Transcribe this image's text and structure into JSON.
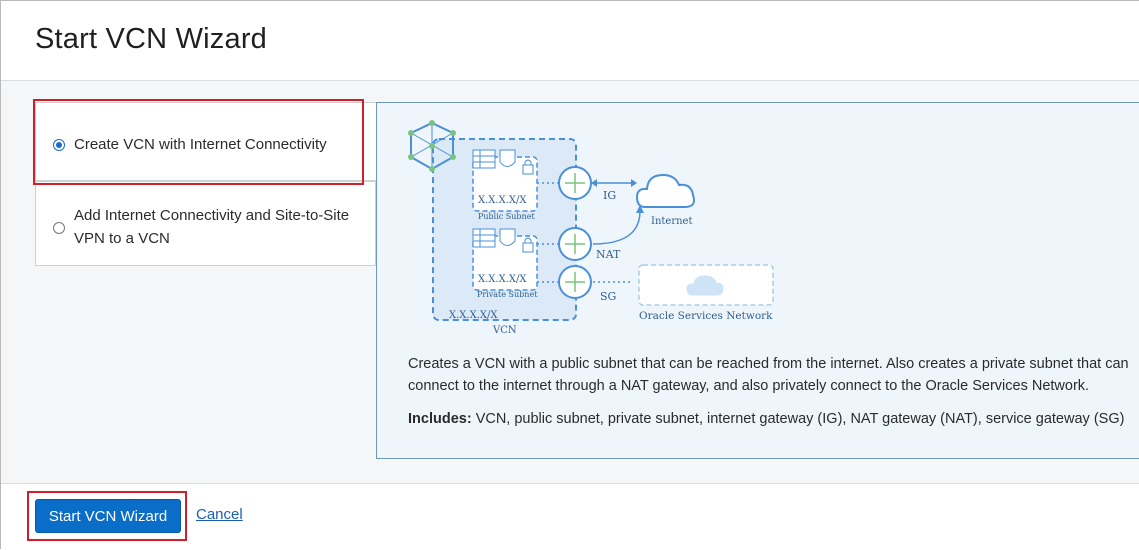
{
  "dialog": {
    "title": "Start VCN Wizard"
  },
  "options": [
    {
      "label_line1": "Create VCN with Internet Connectivity",
      "label_line2": "",
      "selected": true
    },
    {
      "label_line1": "Add Internet Connectivity and Site-to-Site",
      "label_line2": "VPN to a VCN",
      "selected": false
    }
  ],
  "diagram": {
    "public_cidr": "X.X.X.X/X",
    "public_subnet_label": "Public Subnet",
    "private_cidr": "X.X.X.X/X",
    "private_subnet_label": "Private Subnet",
    "vcn_cidr": "X.X.X.X/X",
    "vcn_label": "VCN",
    "ig_label": "IG",
    "nat_label": "NAT",
    "sg_label": "SG",
    "internet_label": "Internet",
    "osn_label": "Oracle Services Network"
  },
  "details": {
    "description_line1": "Creates a VCN with a public subnet that can be reached from the internet. Also creates a private subnet that can",
    "description_line2": "connect to the internet through a NAT gateway, and also privately connect to the Oracle Services Network.",
    "includes_label": "Includes:",
    "includes_text": "VCN, public subnet, private subnet, internet gateway (IG), NAT gateway (NAT), service gateway (SG)"
  },
  "footer": {
    "start_button": "Start VCN Wizard",
    "cancel_link": "Cancel"
  },
  "colors": {
    "primary": "#0a6ec9",
    "highlight": "#d11f2a",
    "diagram_blue": "#4a90d9"
  }
}
